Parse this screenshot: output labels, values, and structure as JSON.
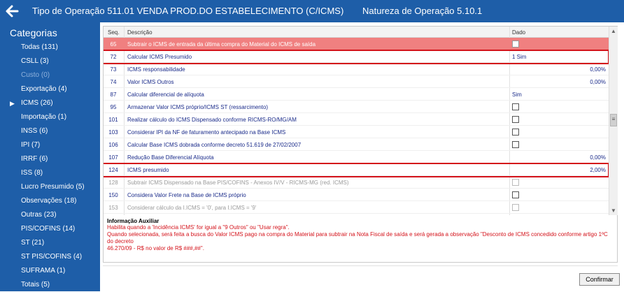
{
  "header": {
    "operation_title": "Tipo de Operação 511.01  VENDA PROD.DO ESTABELECIMENTO (C/ICMS)",
    "nature_title": "Natureza de Operação 5.10.1"
  },
  "sidebar": {
    "title": "Categorias",
    "items": [
      {
        "label": "Todas (131)"
      },
      {
        "label": "CSLL (3)"
      },
      {
        "label": "Custo (0)"
      },
      {
        "label": "Exportação (4)"
      },
      {
        "label": "ICMS (26)",
        "selected_marker": "▶"
      },
      {
        "label": "Importação (1)"
      },
      {
        "label": "INSS (6)"
      },
      {
        "label": "IPI (7)"
      },
      {
        "label": "IRRF (6)"
      },
      {
        "label": "ISS (8)"
      },
      {
        "label": "Lucro Presumido (5)"
      },
      {
        "label": "Observações (18)"
      },
      {
        "label": "Outras (23)"
      },
      {
        "label": "PIS/COFINS (14)"
      },
      {
        "label": "ST (21)"
      },
      {
        "label": "ST PIS/COFINS (4)"
      },
      {
        "label": "SUFRAMA (1)"
      },
      {
        "label": "Totais (5)"
      }
    ]
  },
  "grid": {
    "columns": {
      "seq": "Seq.",
      "desc": "Descrição",
      "value": "Dado"
    },
    "rows": [
      {
        "seq": "65",
        "desc": "Subtrair o ICMS de entrada da última compra do Material do ICMS de saída",
        "value": "",
        "checkbox": true
      },
      {
        "seq": "72",
        "desc": "Calcular ICMS Presumido",
        "value": "1 Sim",
        "checkbox": false
      },
      {
        "seq": "73",
        "desc": "ICMS responsabilidade",
        "value": "0,00%",
        "checkbox": false
      },
      {
        "seq": "74",
        "desc": "Valor ICMS Outros",
        "value": "0,00%",
        "checkbox": false
      },
      {
        "seq": "87",
        "desc": "Calcular diferencial de alíquota",
        "value": "Sim",
        "checkbox": false
      },
      {
        "seq": "95",
        "desc": "Armazenar Valor ICMS próprio/ICMS ST (ressarcimento)",
        "value": "",
        "checkbox": true
      },
      {
        "seq": "101",
        "desc": "Realizar cálculo do ICMS Dispensado conforme RICMS-RO/MG/AM",
        "value": "",
        "checkbox": true
      },
      {
        "seq": "103",
        "desc": "Considerar IPI da NF de faturamento antecipado na Base ICMS",
        "value": "",
        "checkbox": true
      },
      {
        "seq": "106",
        "desc": "Calcular Base ICMS dobrada conforme decreto 51.619 de 27/02/2007",
        "value": "",
        "checkbox": true
      },
      {
        "seq": "107",
        "desc": "Redução Base Diferencial Alíquota",
        "value": "0,00%",
        "checkbox": false
      },
      {
        "seq": "124",
        "desc": "ICMS presumido",
        "value": "2,00%",
        "checkbox": false
      },
      {
        "seq": "128",
        "desc": "Subtrair ICMS Dispensado na Base PIS/COFINS - Anexos IV/V - RICMS-MG (red. ICMS)",
        "value": "",
        "checkbox": true
      },
      {
        "seq": "150",
        "desc": "Considera Valor Frete na Base de ICMS próprio",
        "value": "",
        "checkbox": true
      },
      {
        "seq": "153",
        "desc": "Considerar cálculo da I.ICMS = '0', para I.ICMS = '9'",
        "value": "",
        "checkbox": true
      }
    ]
  },
  "info": {
    "title": "Informação Auxiliar",
    "line1": "Habilita quando a 'Incidência ICMS' for igual a \"9 Outros\" ou \"Usar regra\".",
    "line2": "Quando selecionada, será feita a busca do Valor ICMS pago na compra do Material para subtrair na Nota Fiscal de saída e será gerada a observação \"Desconto de ICMS concedido conforme artigo 1ºC do decreto",
    "line3": "46.270/09 - R$ no valor de R$ ###,##\"."
  },
  "footer": {
    "confirm_label": "Confirmar"
  },
  "colors": {
    "brand": "#1e5ea8",
    "selected_row": "#f08080",
    "highlight_border": "#d4121a",
    "info_text": "#d4121a"
  }
}
